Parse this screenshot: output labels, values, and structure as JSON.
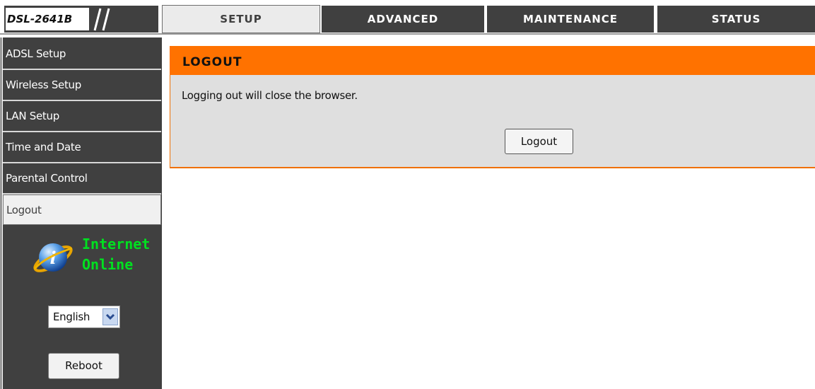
{
  "header": {
    "model": "DSL-2641B",
    "tabs": [
      {
        "label": "SETUP",
        "active": true
      },
      {
        "label": "ADVANCED",
        "active": false
      },
      {
        "label": "MAINTENANCE",
        "active": false
      },
      {
        "label": "STATUS",
        "active": false
      }
    ]
  },
  "sidebar": {
    "items": [
      {
        "label": "ADSL Setup",
        "active": false
      },
      {
        "label": "Wireless Setup",
        "active": false
      },
      {
        "label": "LAN Setup",
        "active": false
      },
      {
        "label": "Time and Date",
        "active": false
      },
      {
        "label": "Parental Control",
        "active": false
      },
      {
        "label": "Logout",
        "active": true
      }
    ],
    "status": {
      "line1": "Internet",
      "line2": "Online",
      "icon": "info-globe-icon",
      "color": "#00e020"
    },
    "language": {
      "value": "English"
    },
    "reboot_label": "Reboot"
  },
  "main": {
    "title": "LOGOUT",
    "message": "Logging out will close the browser.",
    "logout_label": "Logout"
  },
  "colors": {
    "accent": "#ff7200",
    "nav_bg": "#404040",
    "panel_bg": "#dfdfdf"
  }
}
